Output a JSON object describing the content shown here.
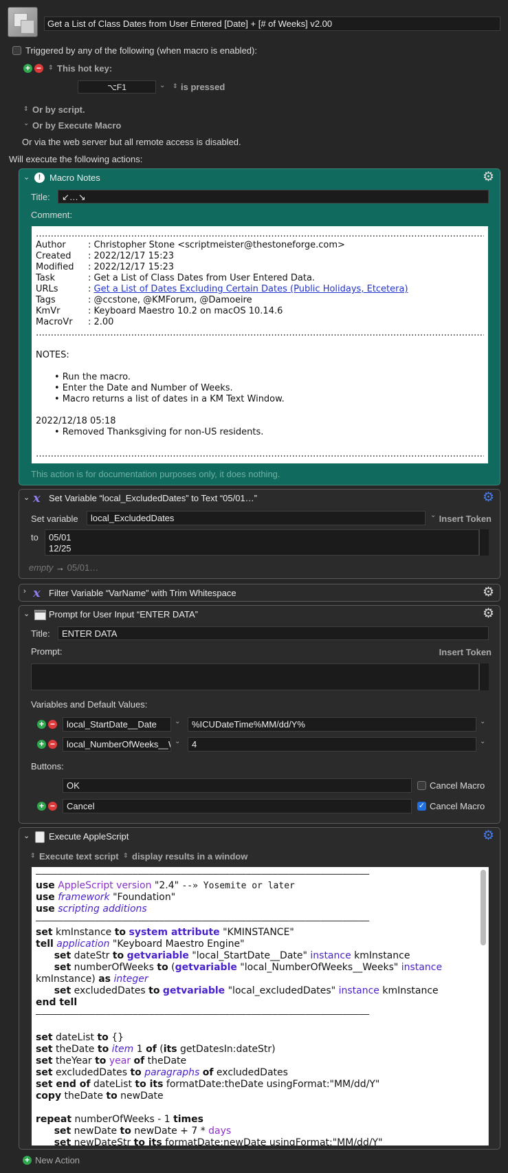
{
  "macro": {
    "name": "Get a List of Class Dates from User Entered [Date] + [# of Weeks] v2.00"
  },
  "triggers": {
    "header": "Triggered by any of the following (when macro is enabled):",
    "hotkey_label": "This hot key:",
    "hotkey_value": "⌥F1",
    "hotkey_state": "is pressed",
    "or_script": "Or by script.",
    "or_execute": "Or by Execute Macro",
    "web_server": "Or via the web server but all remote access is disabled."
  },
  "will_execute": "Will execute the following actions:",
  "actions": {
    "notes": {
      "title": "Macro Notes",
      "title_label": "Title:",
      "title_value": "↙…↘",
      "comment_label": "Comment:",
      "footer": "This action is for documentation purposes only, it does nothing.",
      "dots": "………………………………………………………………………………………………………………………………………………………………………………………………………",
      "author_k": "Author",
      "author_v": ":  Christopher Stone <scriptmeister@thestoneforge.com>",
      "created_k": "Created",
      "created_v": ":  2022/12/17 15:23",
      "modified_k": "Modified",
      "modified_v": ":  2022/12/17 15:23",
      "task_k": "Task",
      "task_v": ":  Get a List of Class Dates from User Entered Data.",
      "urls_k": "URLs",
      "urls_colon": ":  ",
      "urls_link": "Get a List of Dates Excluding Certain Dates (Public Holidays, Etcetera)",
      "tags_k": "Tags",
      "tags_v": ":  @ccstone, @KMForum, @Damoeire",
      "kmvr_k": "KmVr",
      "kmvr_v": ":  Keyboard Maestro 10.2 on macOS 10.14.6",
      "macrovr_k": "MacroVr",
      "macrovr_v": ":  2.00",
      "notes_head": "NOTES:",
      "bullet1": "• Run the macro.",
      "bullet2": "• Enter the Date and Number of Weeks.",
      "bullet3": "• Macro returns a list of dates in a KM Text Window.",
      "date2": "2022/12/18 05:18",
      "bullet4": "• Removed Thanksgiving for non-US residents."
    },
    "setvar": {
      "title": "Set Variable “local_ExcludedDates” to Text “05/01…”",
      "set_label": "Set variable",
      "var_name": "local_ExcludedDates",
      "insert_token": "Insert Token",
      "to_label": "to",
      "line1": "05/01",
      "line2": "12/25",
      "preview_empty": "empty",
      "preview_arrow": "→",
      "preview_value": "05/01…"
    },
    "filter": {
      "title": "Filter Variable “VarName” with Trim Whitespace"
    },
    "prompt": {
      "title": "Prompt for User Input “ENTER DATA”",
      "title_label": "Title:",
      "title_value": "ENTER DATA",
      "prompt_label": "Prompt:",
      "insert_token": "Insert Token",
      "vars_label": "Variables and Default Values:",
      "var1_name": "local_StartDate__Date",
      "var1_default": "%ICUDateTime%MM/dd/Y%",
      "var2_name": "local_NumberOfWeeks__W",
      "var2_default": "4",
      "buttons_label": "Buttons:",
      "btn1": "OK",
      "btn1_cancel": "Cancel Macro",
      "btn2": "Cancel",
      "btn2_cancel": "Cancel Macro"
    },
    "applescript": {
      "title": "Execute AppleScript",
      "mode": "Execute text script",
      "results": "display results in a window",
      "dash": "——————————————————————————————————————————————————————————————"
    }
  },
  "new_action": "New Action"
}
